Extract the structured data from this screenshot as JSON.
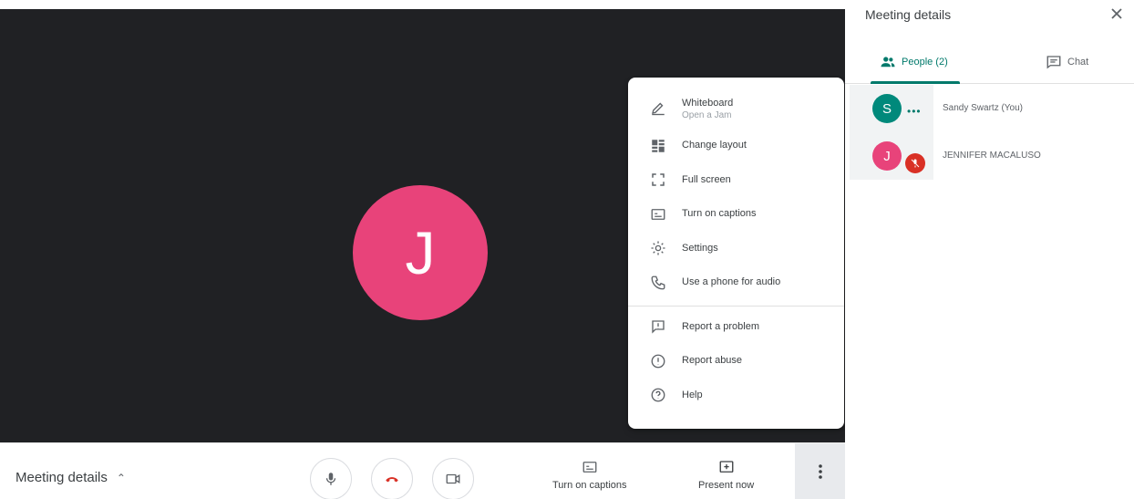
{
  "stage": {
    "main_avatar_initial": "J",
    "main_avatar_color": "#e8437a"
  },
  "menu": {
    "items": [
      {
        "label": "Whiteboard",
        "sublabel": "Open a Jam",
        "icon": "pen-icon"
      },
      {
        "label": "Change layout",
        "icon": "layout-icon"
      },
      {
        "label": "Full screen",
        "icon": "fullscreen-icon"
      },
      {
        "label": "Turn on captions",
        "icon": "captions-icon"
      },
      {
        "label": "Settings",
        "icon": "gear-icon"
      },
      {
        "label": "Use a phone for audio",
        "icon": "phone-audio-icon"
      },
      {
        "label": "Report a problem",
        "icon": "report-problem-icon"
      },
      {
        "label": "Report abuse",
        "icon": "report-abuse-icon"
      },
      {
        "label": "Help",
        "icon": "help-icon"
      }
    ]
  },
  "bottombar": {
    "meeting_details_label": "Meeting details",
    "captions_label": "Turn on captions",
    "present_label": "Present now"
  },
  "panel": {
    "title": "Meeting details",
    "tabs": {
      "people_label": "People (2)",
      "chat_label": "Chat"
    },
    "participants": [
      {
        "initial": "S",
        "name": "Sandy Swartz (You)",
        "color": "#00897b"
      },
      {
        "initial": "J",
        "name": "JENNIFER MACALUSO",
        "color": "#e8437a"
      }
    ]
  },
  "colors": {
    "accent": "#00796b",
    "hangup": "#d93025",
    "stage_bg": "#202124"
  }
}
